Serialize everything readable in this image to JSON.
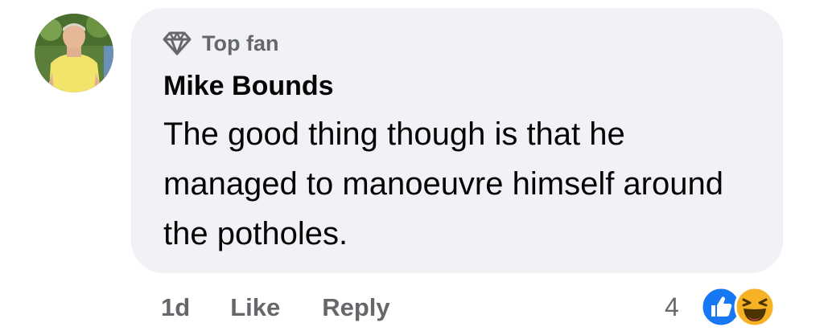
{
  "comment": {
    "badge_label": "Top fan",
    "author": "Mike Bounds",
    "text": "The good thing though is that he managed to manoeuvre himself around the potholes.",
    "time": "1d",
    "like_label": "Like",
    "reply_label": "Reply",
    "reaction_count": "4",
    "reactions": [
      "like-icon",
      "haha-icon"
    ]
  },
  "colors": {
    "bubble_bg": "#f0f2f5",
    "secondary_text": "#65676b",
    "primary_text": "#050505",
    "like_blue": "#1877f2",
    "haha_yellow": "#f7b125"
  }
}
